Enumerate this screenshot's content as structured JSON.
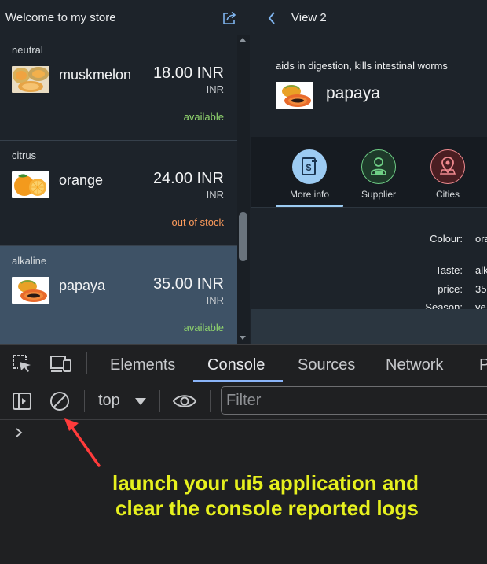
{
  "app": {
    "master_title": "Welcome to my store",
    "items": [
      {
        "category": "neutral",
        "name": "muskmelon",
        "price": "18.00 INR",
        "unit": "INR",
        "status": "available",
        "status_state": "ok"
      },
      {
        "category": "citrus",
        "name": "orange",
        "price": "24.00 INR",
        "unit": "INR",
        "status": "out of stock",
        "status_state": "bad"
      },
      {
        "category": "alkaline",
        "name": "papaya",
        "price": "35.00 INR",
        "unit": "INR",
        "status": "available",
        "status_state": "ok",
        "selected": true
      }
    ],
    "detail": {
      "title": "View 2",
      "description": "aids in digestion, kills intestinal worms",
      "name": "papaya",
      "tabs": [
        {
          "label": "More info",
          "icon": "document-money-icon",
          "selected": true
        },
        {
          "label": "Supplier",
          "icon": "supplier-person-icon"
        },
        {
          "label": "Cities",
          "icon": "map-location-icon"
        }
      ],
      "fields": [
        {
          "label": "Colour:",
          "value": "ora"
        },
        {
          "label": "Taste:",
          "value": "alk"
        },
        {
          "label": "price:",
          "value": "35"
        },
        {
          "label": "Season:",
          "value": "ye"
        }
      ]
    }
  },
  "devtools": {
    "tabs": [
      "Elements",
      "Console",
      "Sources",
      "Network",
      "P"
    ],
    "active_tab": "Console",
    "context": "top",
    "filter_placeholder": "Filter"
  },
  "annotation": {
    "line1": "launch your ui5 application and",
    "line2": "clear the console reported logs"
  },
  "colors": {
    "accent": "#9ccbf2",
    "available": "#8fd36d",
    "out_of_stock": "#ff9c5c",
    "annotation": "#e6f01e",
    "arrow": "#ff3b3b"
  }
}
